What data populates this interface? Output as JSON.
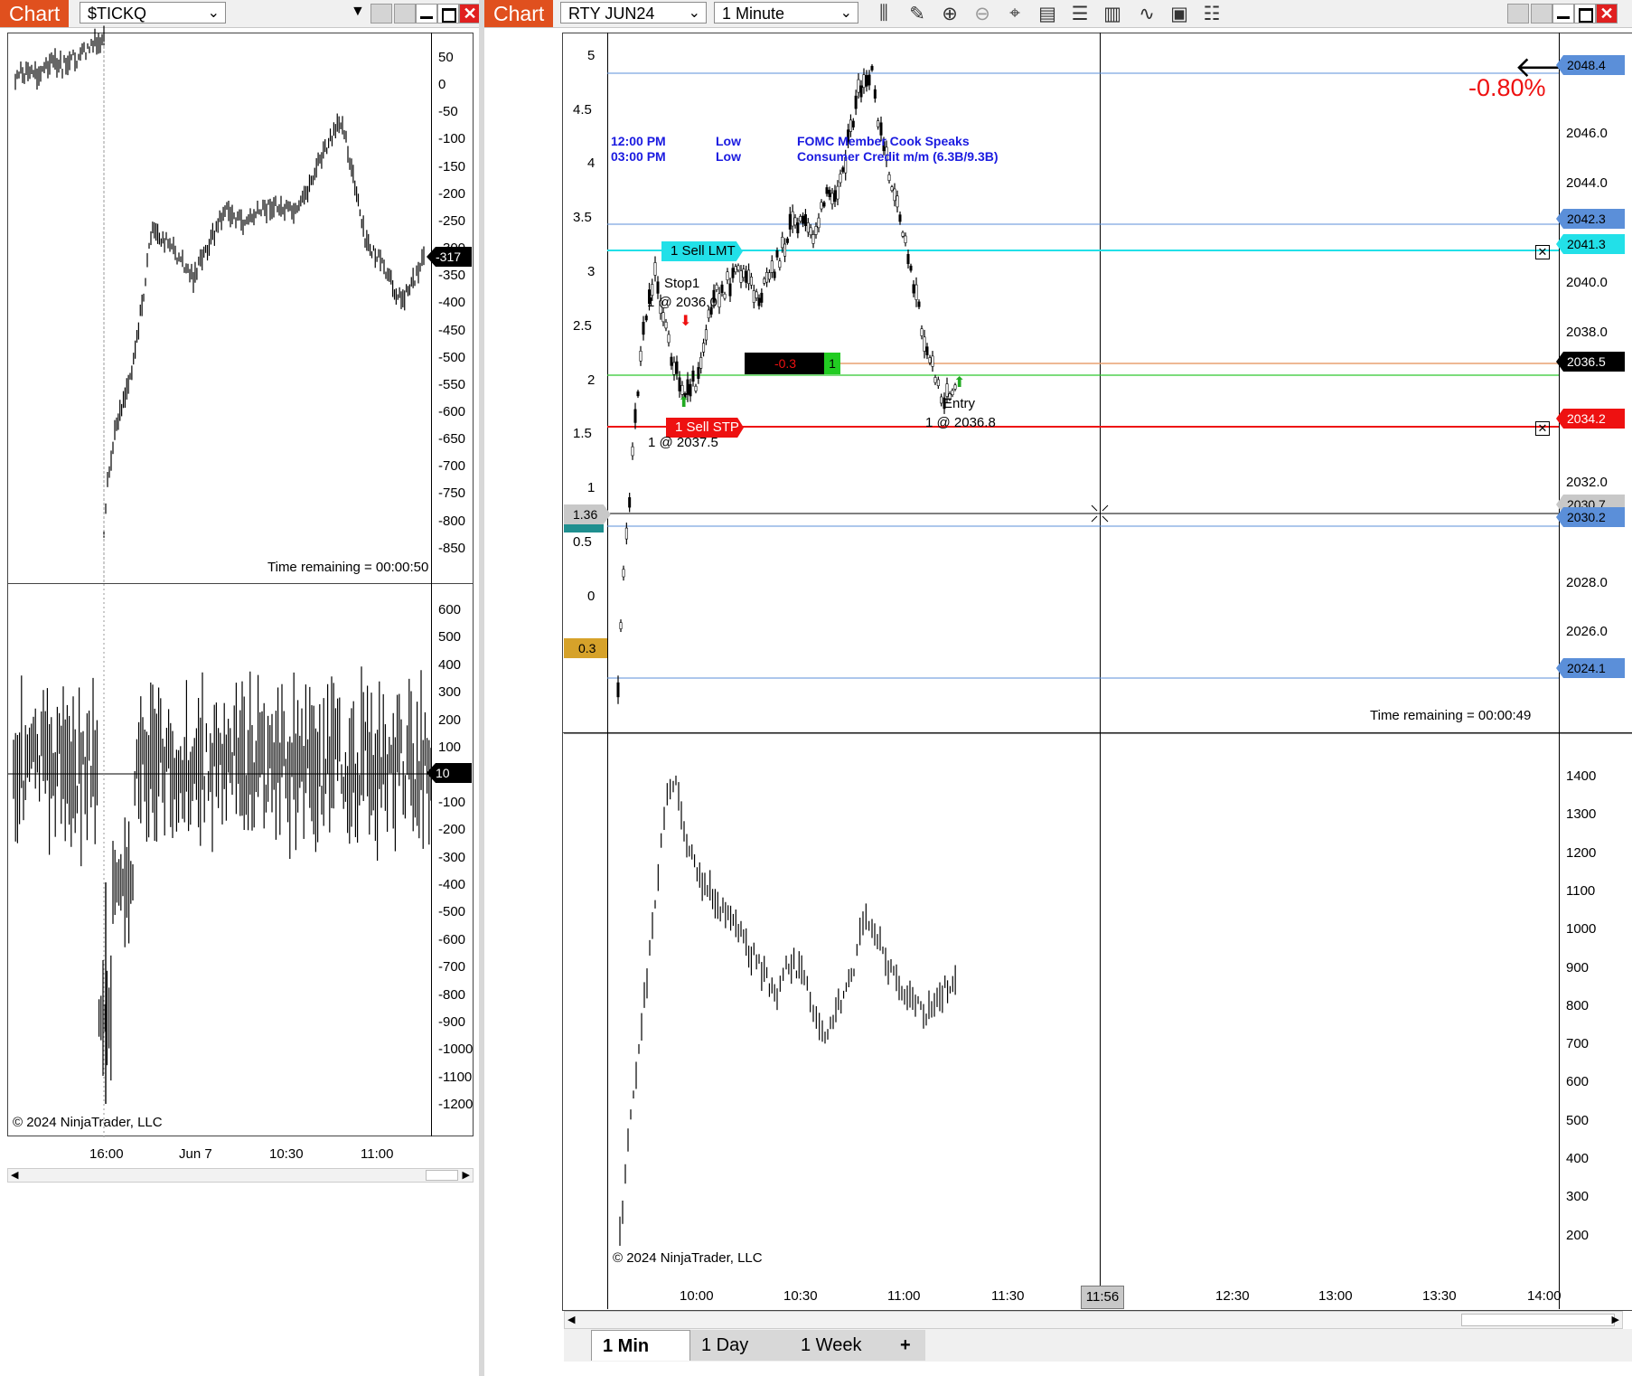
{
  "left_window": {
    "chart_tag": "Chart",
    "instrument": "$TICKQ",
    "upper_panel": {
      "current_value_tag": "-317",
      "time_remaining": "Time remaining = 00:00:50",
      "y_ticks": [
        "50",
        "0",
        "-50",
        "-100",
        "-150",
        "-200",
        "-250",
        "-300",
        "-350",
        "-400",
        "-450",
        "-500",
        "-550",
        "-600",
        "-650",
        "-700",
        "-750",
        "-800",
        "-850"
      ]
    },
    "lower_panel": {
      "current_value_tag": "10",
      "copyright": "© 2024 NinjaTrader, LLC",
      "y_ticks": [
        "600",
        "500",
        "400",
        "300",
        "200",
        "100",
        "0",
        "-100",
        "-200",
        "-300",
        "-400",
        "-500",
        "-600",
        "-700",
        "-800",
        "-900",
        "-1000",
        "-1100",
        "-1200"
      ]
    },
    "x_ticks": [
      "16:00",
      "Jun 7",
      "10:30",
      "11:00"
    ]
  },
  "right_window": {
    "chart_tag": "Chart",
    "instrument": "RTY JUN24",
    "interval": "1 Minute",
    "upper_panel": {
      "percent_change": "-0.80%",
      "left_ticks": [
        "5",
        "4.5",
        "4",
        "3.5",
        "3",
        "2.5",
        "2",
        "1.5",
        "1",
        "0.5",
        "0"
      ],
      "right_ticks": [
        "2046.0",
        "2044.0",
        "2040.0",
        "2038.0",
        "2032.0",
        "2028.0",
        "2026.0"
      ],
      "price_tags": [
        {
          "label": "2048.4",
          "color": "#5b8fd9"
        },
        {
          "label": "2042.3",
          "color": "#5b8fd9"
        },
        {
          "label": "2041.3",
          "color": "#22e0e8"
        },
        {
          "label": "2036.5",
          "color": "#000000"
        },
        {
          "label": "2034.2",
          "color": "#ee1111"
        },
        {
          "label": "2030.7",
          "color": "#c8c8c8"
        },
        {
          "label": "2030.2",
          "color": "#5b8fd9"
        },
        {
          "label": "2024.1",
          "color": "#5b8fd9"
        }
      ],
      "left_tags": [
        {
          "label": "1.36"
        },
        {
          "label": "0.3"
        }
      ],
      "news": [
        {
          "time": "12:00 PM",
          "impact": "Low",
          "event": "FOMC Member Cook Speaks"
        },
        {
          "time": "03:00 PM",
          "impact": "Low",
          "event": "Consumer Credit m/m (6.3B/9.3B)"
        }
      ],
      "orders": {
        "sell_lmt": "1 Sell LMT",
        "sell_stp": "1 Sell STP",
        "position_pnl": "-0.3",
        "position_qty": "1"
      },
      "annotations": {
        "stop_label": "Stop1",
        "stop_price": "1 @ 2036.0",
        "entry_label": "Entry",
        "entry_price": "1 @ 2036.8",
        "fill_price": "1 @ 2037.5"
      },
      "time_remaining": "Time remaining = 00:00:49"
    },
    "lower_panel": {
      "right_ticks": [
        "1400",
        "1300",
        "1200",
        "1100",
        "1000",
        "900",
        "800",
        "700",
        "600",
        "500",
        "400",
        "300",
        "200"
      ],
      "copyright": "© 2024 NinjaTrader, LLC"
    },
    "x_ticks": [
      "10:00",
      "10:30",
      "11:00",
      "11:30",
      "12:30",
      "13:00",
      "13:30",
      "14:00"
    ],
    "cursor_time": "11:56",
    "tabs": [
      "1 Min",
      "1 Day",
      "1 Week",
      "+"
    ]
  }
}
